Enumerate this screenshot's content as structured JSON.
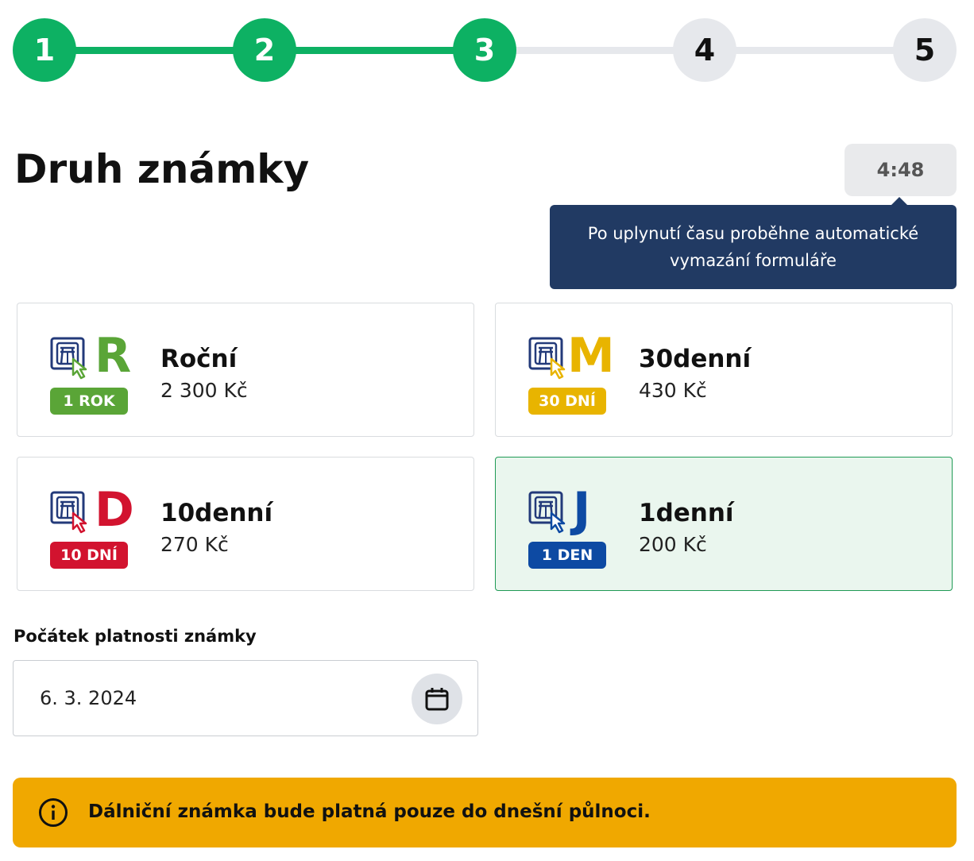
{
  "stepper": {
    "steps": [
      {
        "label": "1",
        "state": "done"
      },
      {
        "label": "2",
        "state": "done"
      },
      {
        "label": "3",
        "state": "done"
      },
      {
        "label": "4",
        "state": "todo"
      },
      {
        "label": "5",
        "state": "todo"
      }
    ],
    "colors": {
      "done": "#0db163",
      "todo": "#e6e8ec"
    }
  },
  "page": {
    "title": "Druh známky"
  },
  "timer": {
    "value": "4:48",
    "tooltip": "Po uplynutí času proběhne automatické vymazání formuláře"
  },
  "vignettes": [
    {
      "letter": "R",
      "badge": "1 ROK",
      "name": "Roční",
      "price": "2 300 Kč",
      "color": "#5aa537",
      "selected": false,
      "icon": "highway-ticket-icon"
    },
    {
      "letter": "M",
      "badge": "30 DNÍ",
      "name": "30denní",
      "price": "430 Kč",
      "color": "#e8b400",
      "selected": false,
      "icon": "highway-ticket-icon"
    },
    {
      "letter": "D",
      "badge": "10 DNÍ",
      "name": "10denní",
      "price": "270 Kč",
      "color": "#d2132f",
      "selected": false,
      "icon": "highway-ticket-icon"
    },
    {
      "letter": "J",
      "badge": "1 DEN",
      "name": "1denní",
      "price": "200 Kč",
      "color": "#0d4aa3",
      "selected": true,
      "icon": "highway-ticket-icon"
    }
  ],
  "validity": {
    "label": "Počátek platnosti známky",
    "value": "6. 3. 2024",
    "icon": "calendar-icon"
  },
  "warning": {
    "icon": "info-icon",
    "text": "Dálniční známka bude platná pouze do dnešní půlnoci.",
    "color": "#f0a800"
  }
}
